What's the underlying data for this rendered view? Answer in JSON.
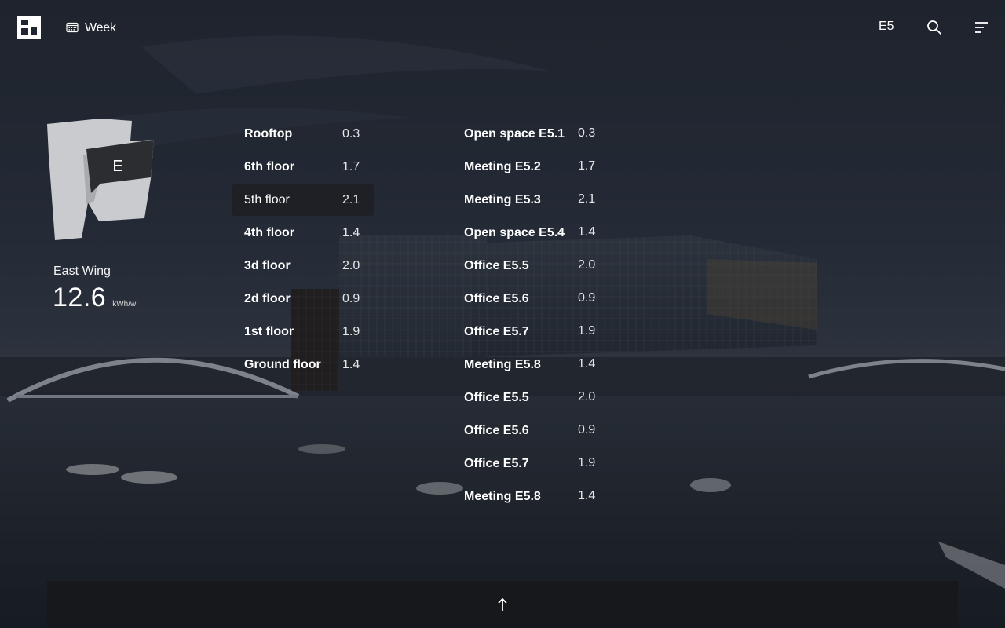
{
  "header": {
    "logo_icon": "building-logo-icon",
    "period": {
      "icon": "calendar-icon",
      "label": "Week"
    },
    "code": "E5",
    "search_icon": "search-icon",
    "menu_icon": "menu-icon"
  },
  "wing": {
    "map_letter": "E",
    "name": "East Wing",
    "value": "12.6",
    "unit": "kWh/w"
  },
  "floors": [
    {
      "name": "Rooftop",
      "value": "0.3"
    },
    {
      "name": "6th floor",
      "value": "1.7"
    },
    {
      "name": "5th floor",
      "value": "2.1",
      "selected": true
    },
    {
      "name": "4th floor",
      "value": "1.4"
    },
    {
      "name": "3d floor",
      "value": "2.0"
    },
    {
      "name": "2d floor",
      "value": "0.9"
    },
    {
      "name": "1st floor",
      "value": "1.9"
    },
    {
      "name": "Ground floor",
      "value": "1.4"
    }
  ],
  "rooms": [
    {
      "name": "Open space E5.1",
      "value": "0.3"
    },
    {
      "name": "Meeting E5.2",
      "value": "1.7"
    },
    {
      "name": "Meeting E5.3",
      "value": "2.1"
    },
    {
      "name": "Open space E5.4",
      "value": "1.4"
    },
    {
      "name": "Office E5.5",
      "value": "2.0"
    },
    {
      "name": "Office E5.6",
      "value": "0.9"
    },
    {
      "name": "Office E5.7",
      "value": "1.9"
    },
    {
      "name": "Meeting E5.8",
      "value": "1.4"
    },
    {
      "name": "Office E5.5",
      "value": "2.0"
    },
    {
      "name": "Office E5.6",
      "value": "0.9"
    },
    {
      "name": "Office E5.7",
      "value": "1.9"
    },
    {
      "name": "Meeting E5.8",
      "value": "1.4"
    }
  ],
  "footer": {
    "icon": "arrow-up-icon"
  },
  "colors": {
    "background": "#1f2631",
    "selected_row": "#1e2024",
    "bottom_bar": "#16181c",
    "map_light": "#c9cbcf",
    "map_dark": "#2b2d31"
  }
}
